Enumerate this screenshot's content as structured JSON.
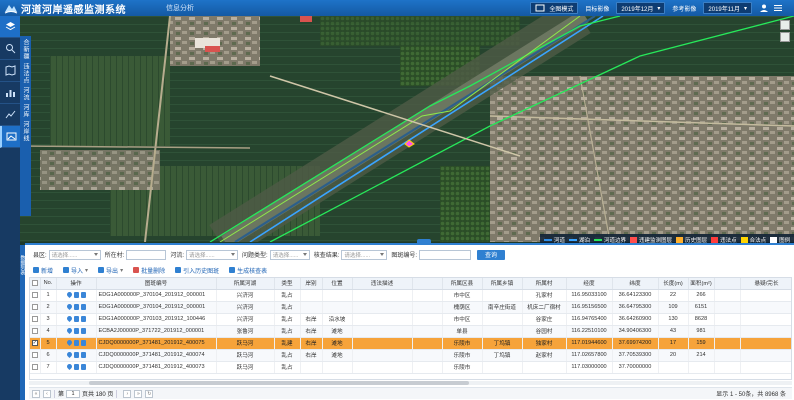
{
  "header": {
    "title": "河道河岸遥感监测系统",
    "nav_tab": "信息分析",
    "mode_label": "全图模式",
    "target_label": "目标影像",
    "target_date": "2019年12月",
    "ref_label": "参考影像",
    "ref_date": "2019年11月"
  },
  "sidebar": {
    "items": [
      {
        "icon": "layers-icon"
      },
      {
        "icon": "search-icon"
      },
      {
        "icon": "map-icon"
      },
      {
        "icon": "chart-icon"
      },
      {
        "icon": "list-icon"
      },
      {
        "icon": "image-icon"
      }
    ],
    "layer_labels": [
      "合新疆",
      "违法点",
      "河流",
      "河库",
      "河岸线"
    ]
  },
  "legend": {
    "items": [
      {
        "label": "河道",
        "color": "#2f8fe8"
      },
      {
        "label": "湖泊",
        "color": "#3aa4ff"
      },
      {
        "label": "河道边界",
        "color": "#27e85a"
      },
      {
        "label": "违建监测图层",
        "color": "#ff4d4d"
      },
      {
        "label": "历史图层",
        "color": "#ffb02e"
      },
      {
        "label": "违法点",
        "color": "#ff3b3b"
      },
      {
        "label": "合法点",
        "color": "#ffd400"
      },
      {
        "label": "图例",
        "color": "#ffffff"
      }
    ]
  },
  "filters": {
    "county_label": "县区:",
    "county_placeholder": "请选择......",
    "town_label": "所在村:",
    "river_label": "河流:",
    "river_placeholder": "请选择......",
    "issue_label": "问题类型:",
    "issue_placeholder": "请选择......",
    "result_label": "核查结果:",
    "result_placeholder": "请选择......",
    "code_label": "图斑编号:",
    "query": "查询"
  },
  "toolbar": {
    "add": "新增",
    "import": "导入",
    "export": "导出",
    "batch_delete": "批量删除",
    "import_history": "引入历史图斑",
    "gen_report": "生成核查表"
  },
  "table": {
    "columns": [
      "",
      "No.",
      "操作",
      "图斑编号",
      "所属河湖",
      "类型",
      "岸别",
      "位置",
      "违法描述",
      "",
      "所属区县",
      "所属乡镇",
      "所属村",
      "经度",
      "纬度",
      "长度(m)",
      "面积(m²)",
      "",
      "悬疑/完长"
    ],
    "rows": [
      {
        "no": "1",
        "code": "EDG1A000000P_370104_201912_000001",
        "river": "兴济河",
        "type": "乱占",
        "bank": "",
        "pos": "",
        "desc": "",
        "county": "市中区",
        "town": "",
        "village": "孔家村",
        "lng": "116.95033100",
        "lat": "36.64123300",
        "len": "22",
        "area": "266",
        "sel": false
      },
      {
        "no": "2",
        "code": "EDG1A000000P_370104_201912_000001",
        "river": "兴济河",
        "type": "乱占",
        "bank": "",
        "pos": "",
        "desc": "",
        "county": "槐荫区",
        "town": "南辛庄街道",
        "village": "机床二厂宿村",
        "lng": "116.95156500",
        "lat": "36.64795300",
        "len": "109",
        "area": "6151",
        "sel": false
      },
      {
        "no": "3",
        "code": "EDG1A000000P_370103_201912_100446",
        "river": "兴济河",
        "type": "乱占",
        "bank": "右岸",
        "pos": "沿水坡",
        "desc": "",
        "county": "市中区",
        "town": "",
        "village": "谷家庄",
        "lng": "116.94765400",
        "lat": "36.64260900",
        "len": "130",
        "area": "8628",
        "sel": false
      },
      {
        "no": "4",
        "code": "ECBA2J00000P_371722_201912_000001",
        "river": "张鲁河",
        "type": "乱占",
        "bank": "右岸",
        "pos": "滩地",
        "desc": "",
        "county": "单县",
        "town": "",
        "village": "谷园村",
        "lng": "116.22510100",
        "lat": "34.90406300",
        "len": "43",
        "area": "981",
        "sel": false
      },
      {
        "no": "5",
        "code": "CJDQ0000000P_371481_201912_400075",
        "river": "跃马河",
        "type": "乱建",
        "bank": "右岸",
        "pos": "滩地",
        "desc": "",
        "county": "乐陵市",
        "town": "丁坞镇",
        "village": "独家村",
        "lng": "117.01944600",
        "lat": "37.69974200",
        "len": "17",
        "area": "159",
        "sel": true
      },
      {
        "no": "6",
        "code": "CJDQ0000000P_371481_201912_400074",
        "river": "跃马河",
        "type": "乱占",
        "bank": "右岸",
        "pos": "滩地",
        "desc": "",
        "county": "乐陵市",
        "town": "丁坞镇",
        "village": "赵家村",
        "lng": "117.02657800",
        "lat": "37.70539300",
        "len": "20",
        "area": "214",
        "sel": false
      },
      {
        "no": "7",
        "code": "CJDQ0000000P_371481_201912_400073",
        "river": "跃马河",
        "type": "乱占",
        "bank": "",
        "pos": "",
        "desc": "",
        "county": "乐陵市",
        "town": "",
        "village": "",
        "lng": "117.03000000",
        "lat": "37.70000000",
        "len": "",
        "area": "",
        "sel": false
      }
    ]
  },
  "pager": {
    "page_prefix": "第",
    "page": "1",
    "page_suffix": "页共 180 页",
    "info": "显示 1 - 50条，共 8968 条"
  }
}
